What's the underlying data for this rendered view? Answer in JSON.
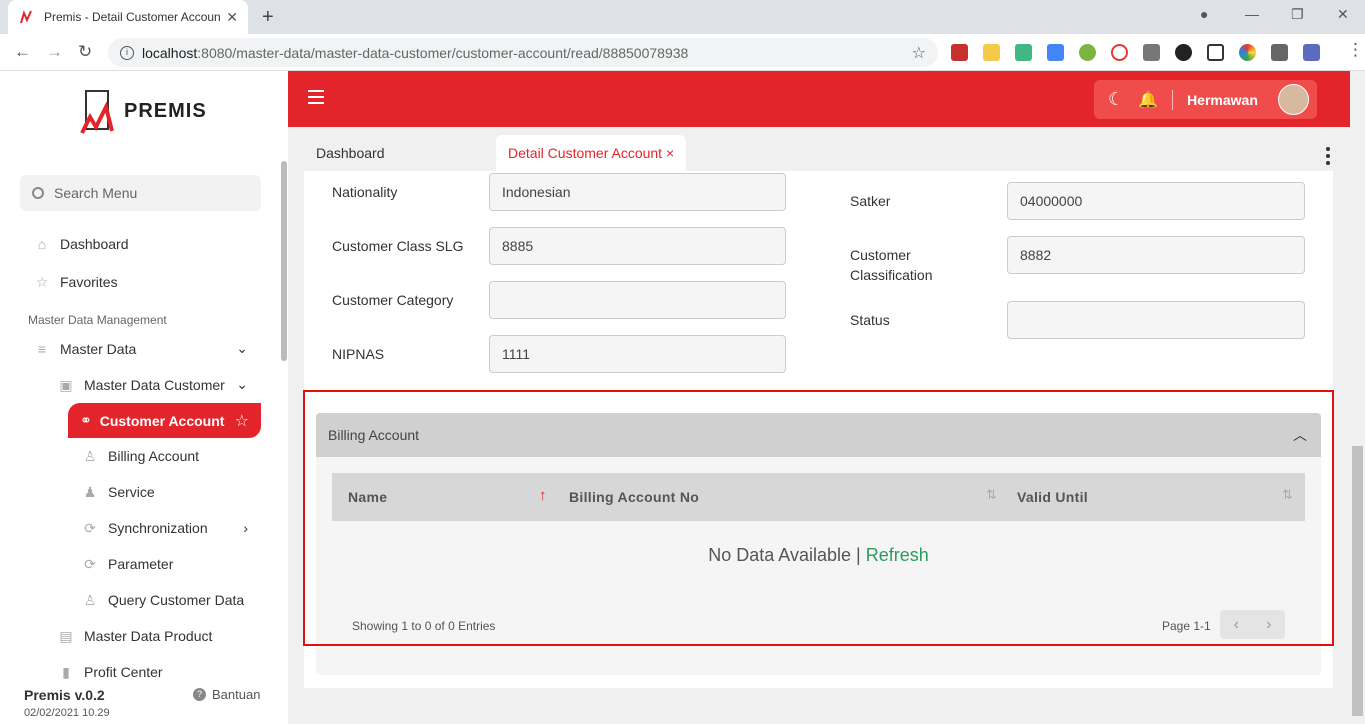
{
  "browser": {
    "tab_title": "Premis - Detail Customer Accoun",
    "url_host": "localhost",
    "url_rest": ":8080/master-data/master-data-customer/customer-account/read/88850078938"
  },
  "app": {
    "logo": "PREMIS",
    "search_placeholder": "Search Menu",
    "user": "Hermawan",
    "version": "Premis v.0.2",
    "date": "02/02/2021 10.29",
    "help": "Bantuan"
  },
  "menu": {
    "dashboard": "Dashboard",
    "favorites": "Favorites",
    "group": "Master Data Management",
    "master_data": "Master Data",
    "master_customer": "Master Data Customer",
    "customer_account": "Customer Account",
    "billing_account": "Billing Account",
    "service": "Service",
    "synchronization": "Synchronization",
    "parameter": "Parameter",
    "query": "Query Customer Data",
    "master_product": "Master Data Product",
    "profit_center": "Profit Center"
  },
  "tabs": {
    "t1": "Dashboard",
    "t2": "Detail Customer Account ×"
  },
  "form": {
    "nationality_label": "Nationality",
    "nationality": "Indonesian",
    "class_label": "Customer Class SLG",
    "class": "8885",
    "category_label": "Customer Category",
    "category": "",
    "nipnas_label": "NIPNAS",
    "nipnas": "1111",
    "satker_label": "Satker",
    "satker": "04000000",
    "classification_label": "Customer Classification",
    "classification": "8882",
    "status_label": "Status",
    "status": ""
  },
  "billing": {
    "title": "Billing Account",
    "col_name": "Name",
    "col_no": "Billing Account No",
    "col_valid": "Valid Until",
    "no_data": "No Data Available | ",
    "refresh": "Refresh",
    "showing": "Showing 1 to 0 of 0 Entries",
    "page": "Page 1-1"
  }
}
